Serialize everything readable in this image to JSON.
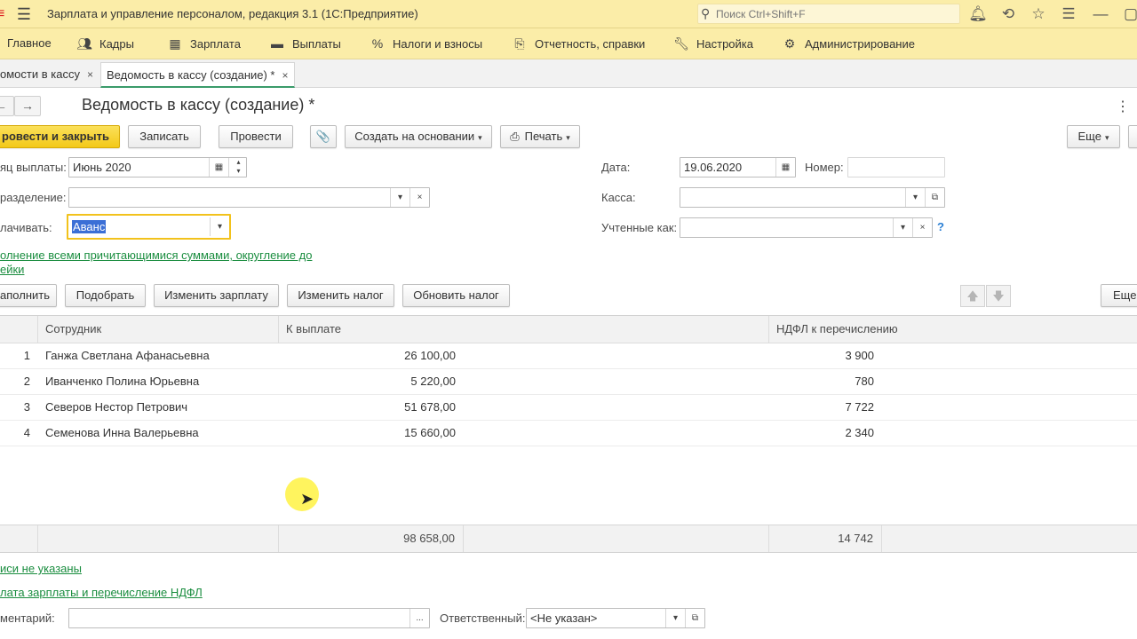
{
  "app": {
    "title": "Зарплата и управление персоналом, редакция 3.1  (1С:Предприятие)",
    "search_placeholder": "Поиск Ctrl+Shift+F",
    "accent": "#fbeda8"
  },
  "sections": [
    {
      "label": "Главное",
      "icon": "home-icon"
    },
    {
      "label": "Кадры",
      "icon": "people-icon"
    },
    {
      "label": "Зарплата",
      "icon": "calculator-icon"
    },
    {
      "label": "Выплаты",
      "icon": "wallet-icon"
    },
    {
      "label": "Налоги и взносы",
      "icon": "percent-icon"
    },
    {
      "label": "Отчетность, справки",
      "icon": "report-icon"
    },
    {
      "label": "Настройка",
      "icon": "wrench-icon"
    },
    {
      "label": "Администрирование",
      "icon": "gear-icon"
    }
  ],
  "tabs": [
    {
      "label": "омости в кассу",
      "close": "×"
    },
    {
      "label": "Ведомость в кассу (создание) *",
      "close": "×"
    }
  ],
  "form": {
    "title": "Ведомость в кассу (создание) *",
    "nav_back": "←",
    "nav_forward": "→",
    "kebab": "⋮",
    "buttons": {
      "post_close": "ровести и закрыть",
      "save": "Записать",
      "post": "Провести",
      "attach": "📎",
      "create_based": "Создать на основании",
      "print": "Печать",
      "more": "Еще"
    },
    "fields": {
      "month_label": "яц выплаты:",
      "month_value": "Июнь 2020",
      "dept_label": "разделение:",
      "dept_value": "",
      "pay_label": "лачивать:",
      "pay_value": "Аванс",
      "date_label": "Дата:",
      "date_value": "19.06.2020",
      "number_label": "Номер:",
      "number_value": "",
      "cash_label": "Касса:",
      "cash_value": "",
      "accounted_label": "Учтенные как:",
      "accounted_value": "",
      "help": "?"
    },
    "fill_link_line1": "олнение всеми причитающимися суммами, округление до",
    "fill_link_line2": "ейки"
  },
  "table_toolbar": {
    "fill": "аполнить",
    "pick": "Подобрать",
    "change_salary": "Изменить зарплату",
    "change_tax": "Изменить налог",
    "update_tax": "Обновить налог",
    "up": "🡅",
    "down": "🡇",
    "more": "Еще"
  },
  "table": {
    "columns": [
      "Сотрудник",
      "К выплате",
      "НДФЛ к перечислению"
    ],
    "rows": [
      {
        "n": "1",
        "employee": "Ганжа Светлана Афанасьевна",
        "pay": "26 100,00",
        "tax": "3 900"
      },
      {
        "n": "2",
        "employee": "Иванченко Полина Юрьевна",
        "pay": "5 220,00",
        "tax": "780"
      },
      {
        "n": "3",
        "employee": "Северов Нестор Петрович",
        "pay": "51 678,00",
        "tax": "7 722"
      },
      {
        "n": "4",
        "employee": "Семенова Инна Валерьевна",
        "pay": "15 660,00",
        "tax": "2 340"
      }
    ],
    "totals": {
      "pay": "98 658,00",
      "tax": "14 742"
    }
  },
  "footer": {
    "signatures_link": "иси не указаны",
    "payment_link": "лата зарплаты и перечисление НДФЛ",
    "comment_label": "ментарий:",
    "comment_value": "",
    "comment_btn": "...",
    "responsible_label": "Ответственный:",
    "responsible_value": "<Не указан>"
  }
}
